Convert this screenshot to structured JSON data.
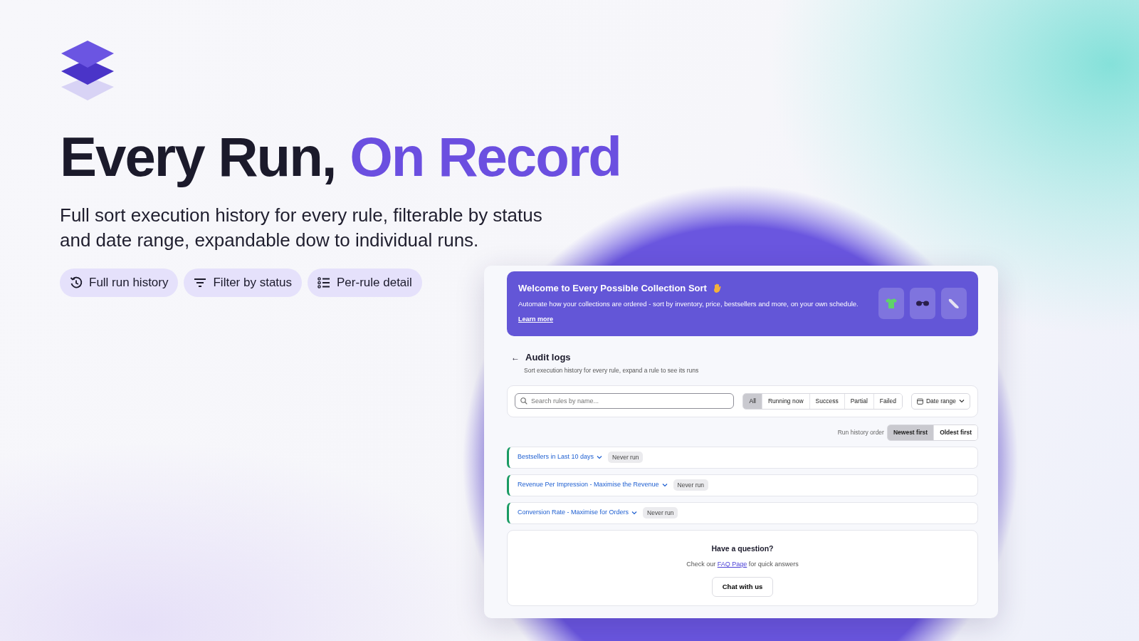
{
  "headline": {
    "text": "Every Run,",
    "highlight": "On Record"
  },
  "subtitle": "Full sort execution history for every rule, filterable by status and date range, expandable dow to individual runs.",
  "features": [
    {
      "label": "Full run history",
      "kind": "history"
    },
    {
      "label": "Filter by status",
      "kind": "filter"
    },
    {
      "label": "Per-rule detail",
      "kind": "list"
    }
  ],
  "app": {
    "banner": {
      "title": "Welcome to Every Possible Collection Sort",
      "text": "Automate how your collections are ordered - sort by inventory, price, bestsellers and more, on your own schedule.",
      "link": "Learn more"
    },
    "page": {
      "back": "←",
      "title": "Audit logs",
      "subtitle": "Sort execution history for every rule, expand a rule to see its runs"
    },
    "search": {
      "placeholder": "Search rules by name..."
    },
    "status_filters": [
      {
        "label": "All",
        "selected": true
      },
      {
        "label": "Running now",
        "selected": false
      },
      {
        "label": "Success",
        "selected": false
      },
      {
        "label": "Partial",
        "selected": false
      },
      {
        "label": "Failed",
        "selected": false
      }
    ],
    "date_range": "Date range",
    "order": {
      "label": "Run history order",
      "options": [
        {
          "label": "Newest first",
          "selected": true
        },
        {
          "label": "Oldest first",
          "selected": false
        }
      ]
    },
    "rules": [
      {
        "name": "Bestsellers in Last 10 days",
        "status": "Never run"
      },
      {
        "name": "Revenue Per Impression - Maximise the Revenue",
        "status": "Never run"
      },
      {
        "name": "Conversion Rate - Maximise for Orders",
        "status": "Never run"
      }
    ],
    "help": {
      "title": "Have a question?",
      "before": "Check our",
      "link": "FAQ Page",
      "after": "for quick answers",
      "button": "Chat with us"
    }
  }
}
